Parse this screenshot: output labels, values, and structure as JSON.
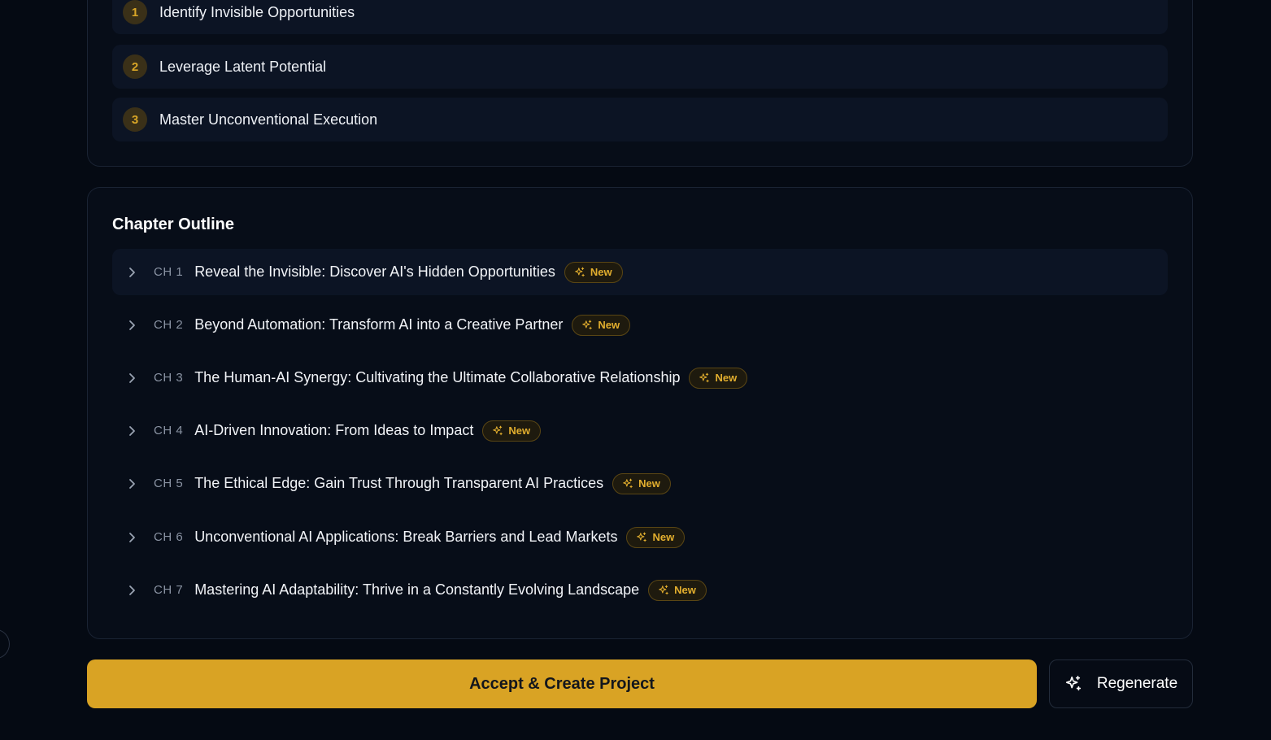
{
  "outcomes": [
    {
      "number": "1",
      "text": "Identify Invisible Opportunities"
    },
    {
      "number": "2",
      "text": "Leverage Latent Potential"
    },
    {
      "number": "3",
      "text": "Master Unconventional Execution"
    }
  ],
  "outline": {
    "title": "Chapter Outline",
    "badge_label": "New",
    "chapters": [
      {
        "label": "CH 1",
        "title": "Reveal the Invisible: Discover AI's Hidden Opportunities",
        "badge": "New"
      },
      {
        "label": "CH 2",
        "title": "Beyond Automation: Transform AI into a Creative Partner",
        "badge": "New"
      },
      {
        "label": "CH 3",
        "title": "The Human-AI Synergy: Cultivating the Ultimate Collaborative Relationship",
        "badge": "New"
      },
      {
        "label": "CH 4",
        "title": "AI-Driven Innovation: From Ideas to Impact",
        "badge": "New"
      },
      {
        "label": "CH 5",
        "title": "The Ethical Edge: Gain Trust Through Transparent AI Practices",
        "badge": "New"
      },
      {
        "label": "CH 6",
        "title": "Unconventional AI Applications: Break Barriers and Lead Markets",
        "badge": "New"
      },
      {
        "label": "CH 7",
        "title": "Mastering AI Adaptability: Thrive in a Constantly Evolving Landscape",
        "badge": "New"
      }
    ]
  },
  "actions": {
    "accept_label": "Accept & Create Project",
    "regenerate_label": "Regenerate"
  },
  "icons": {
    "chevron": "chevron-right-icon",
    "badge": "sparkles-icon",
    "regenerate": "sparkles-icon"
  },
  "colors": {
    "accent": "#d9a324",
    "background": "#050a13",
    "badge_text": "#e2ae2e"
  }
}
